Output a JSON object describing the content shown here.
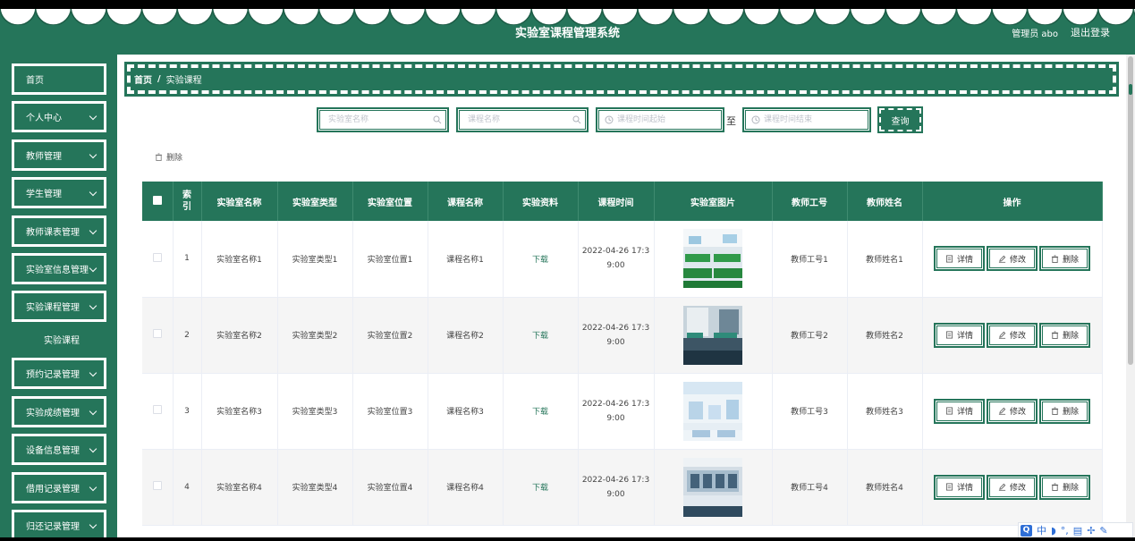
{
  "header": {
    "title": "实验室课程管理系统",
    "user_label": "管理员 abo",
    "logout_label": "退出登录",
    "theme_color": "#25755a"
  },
  "sidebar": {
    "items": [
      {
        "label": "首页",
        "has_arrow": false
      },
      {
        "label": "个人中心",
        "has_arrow": true
      },
      {
        "label": "教师管理",
        "has_arrow": true
      },
      {
        "label": "学生管理",
        "has_arrow": true
      },
      {
        "label": "教师课表管理",
        "has_arrow": true
      },
      {
        "label": "实验室信息管理",
        "has_arrow": true
      },
      {
        "label": "实验课程管理",
        "has_arrow": true
      },
      {
        "label": "预约记录管理",
        "has_arrow": true
      },
      {
        "label": "实验成绩管理",
        "has_arrow": true
      },
      {
        "label": "设备信息管理",
        "has_arrow": true
      },
      {
        "label": "借用记录管理",
        "has_arrow": true
      },
      {
        "label": "归还记录管理",
        "has_arrow": true
      }
    ],
    "sub_item": {
      "label": "实验课程"
    }
  },
  "breadcrumb": {
    "home": "首页",
    "separator": "/",
    "current": "实验课程"
  },
  "search": {
    "lab_name_placeholder": "实验室名称",
    "course_name_placeholder": "课程名称",
    "time_start_placeholder": "课程时间起始",
    "time_end_placeholder": "课程时间结束",
    "to_label": "至",
    "query_label": "查询"
  },
  "actions": {
    "delete_label": "删除"
  },
  "table": {
    "headers": [
      "索引",
      "实验室名称",
      "实验室类型",
      "实验室位置",
      "课程名称",
      "实验资料",
      "课程时间",
      "实验室图片",
      "教师工号",
      "教师姓名",
      "操作"
    ],
    "rows": [
      {
        "index": "1",
        "lab_name": "实验室名称1",
        "lab_type": "实验室类型1",
        "lab_location": "实验室位置1",
        "course_name": "课程名称1",
        "material": "下载",
        "time_line1": "2022-04-26 17:3",
        "time_line2": "9:00",
        "teacher_id": "教师工号1",
        "teacher_name": "教师姓名1"
      },
      {
        "index": "2",
        "lab_name": "实验室名称2",
        "lab_type": "实验室类型2",
        "lab_location": "实验室位置2",
        "course_name": "课程名称2",
        "material": "下载",
        "time_line1": "2022-04-26 17:3",
        "time_line2": "9:00",
        "teacher_id": "教师工号2",
        "teacher_name": "教师姓名2"
      },
      {
        "index": "3",
        "lab_name": "实验室名称3",
        "lab_type": "实验室类型3",
        "lab_location": "实验室位置3",
        "course_name": "课程名称3",
        "material": "下载",
        "time_line1": "2022-04-26 17:3",
        "time_line2": "9:00",
        "teacher_id": "教师工号3",
        "teacher_name": "教师姓名3"
      },
      {
        "index": "4",
        "lab_name": "实验室名称4",
        "lab_type": "实验室类型4",
        "lab_location": "实验室位置4",
        "course_name": "课程名称4",
        "material": "下载",
        "time_line1": "2022-04-26 17:3",
        "time_line2": "9:00",
        "teacher_id": "教师工号4",
        "teacher_name": "教师姓名4"
      }
    ],
    "row_buttons": {
      "detail": "详情",
      "edit": "修改",
      "delete": "删除"
    }
  },
  "ime": {
    "lang": "中"
  }
}
